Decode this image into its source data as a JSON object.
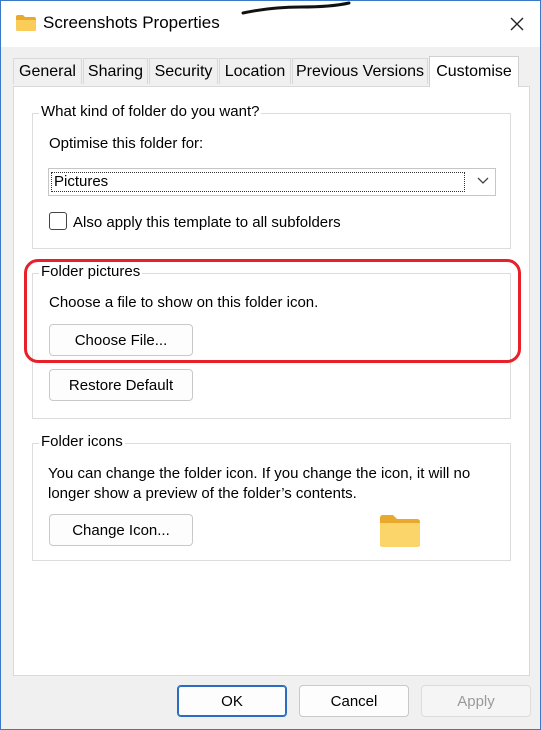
{
  "window": {
    "title": "Screenshots Properties",
    "close_icon": "close-icon",
    "title_icon": "folder-icon"
  },
  "tabs": [
    {
      "label": "General"
    },
    {
      "label": "Sharing"
    },
    {
      "label": "Security"
    },
    {
      "label": "Location"
    },
    {
      "label": "Previous Versions"
    },
    {
      "label": "Customise",
      "active": true
    }
  ],
  "kind_group": {
    "title": "What kind of folder do you want?",
    "optimise_label": "Optimise this folder for:",
    "optimise_value": "Pictures",
    "apply_subfolders_label": "Also apply this template to all subfolders",
    "apply_subfolders_checked": false
  },
  "pictures_group": {
    "title": "Folder pictures",
    "description": "Choose a file to show on this folder icon.",
    "choose_file_label": "Choose File...",
    "restore_default_label": "Restore Default"
  },
  "icons_group": {
    "title": "Folder icons",
    "description_line1": "You can change the folder icon. If you change the icon, it will no",
    "description_line2": "longer show a preview of the folder’s contents.",
    "change_icon_label": "Change Icon..."
  },
  "footer": {
    "ok_label": "OK",
    "cancel_label": "Cancel",
    "apply_label": "Apply"
  },
  "colors": {
    "accent": "#2a6cc2",
    "highlight": "#e8202a",
    "folder": "#f8c94c"
  }
}
